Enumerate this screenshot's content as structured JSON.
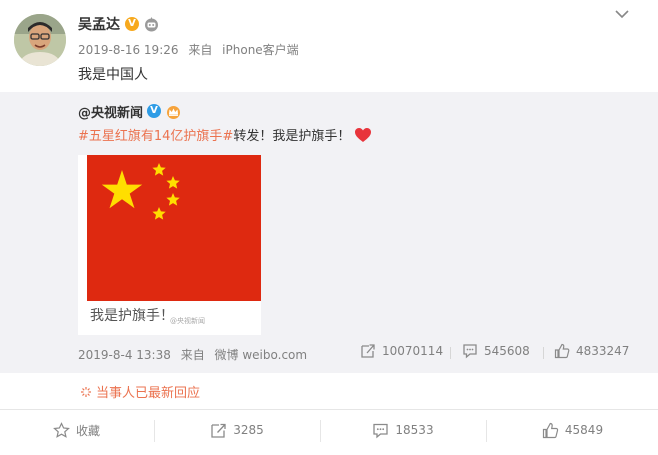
{
  "post": {
    "author": "吴孟达",
    "date": "2019-8-16 19:26",
    "source_prefix": "来自",
    "source": "iPhone客户端",
    "text": "我是中国人"
  },
  "repost": {
    "author": "@央视新闻",
    "hashtag": "#五星红旗有14亿护旗手#",
    "text": "转发！我是护旗手！",
    "image_caption": "我是护旗手！",
    "image_watermark": "@央视新闻",
    "date": "2019-8-4 13:38",
    "source_prefix": "来自",
    "source": "微博 weibo.com",
    "stats": {
      "reposts": "10070114",
      "comments": "545608",
      "likes": "4833247"
    }
  },
  "notice": {
    "text": "当事人已最新回应"
  },
  "actions": {
    "favorite": "收藏",
    "repost": "3285",
    "comment": "18533",
    "like": "45849"
  },
  "colors": {
    "accent_orange": "#eb7350",
    "link_orange": "#eb7350",
    "flag_red": "#de2910",
    "flag_yellow": "#ffde00",
    "verified_orange": "#f7a91e",
    "verified_blue": "#2e9ce6",
    "repost_bg": "#f2f2f5"
  },
  "icons": [
    "robot-icon",
    "chevron-down-icon",
    "crown-icon",
    "heart-icon",
    "share-icon",
    "comment-icon",
    "like-icon",
    "star-icon",
    "warning-icon"
  ]
}
